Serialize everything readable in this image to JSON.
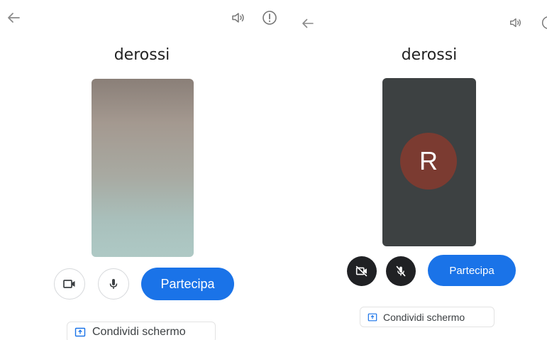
{
  "left_panel": {
    "title": "derossi",
    "join_label": "Partecipa",
    "share_label": "Condividi schermo"
  },
  "right_panel": {
    "title": "derossi",
    "avatar_initial": "R",
    "join_label": "Partecipa",
    "share_label": "Condividi schermo"
  },
  "colors": {
    "primary_blue": "#1a73e8",
    "avatar_bg": "#7b3b31",
    "dark_button": "#202124"
  }
}
